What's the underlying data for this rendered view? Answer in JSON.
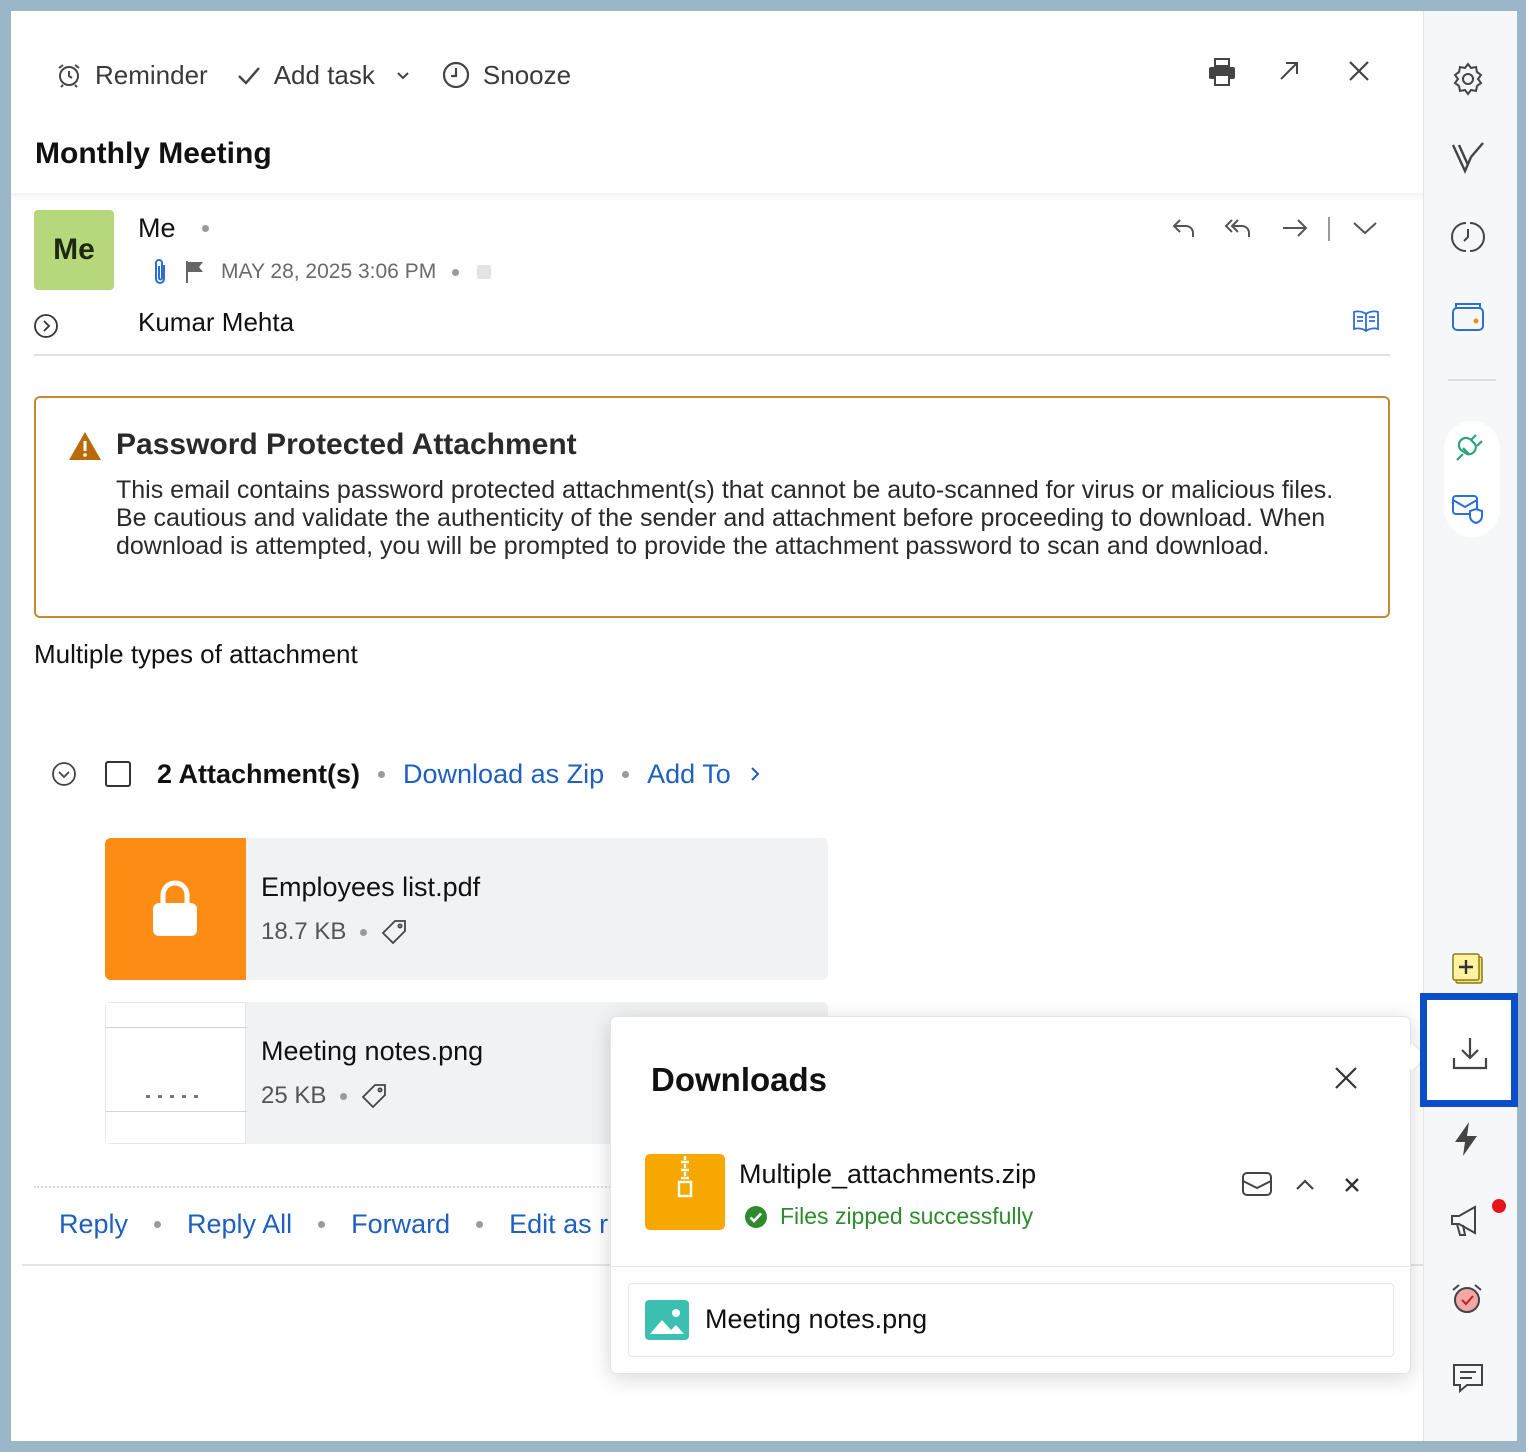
{
  "toolbar": {
    "reminder_label": "Reminder",
    "add_task_label": "Add task",
    "snooze_label": "Snooze"
  },
  "email": {
    "subject": "Monthly Meeting",
    "avatar_initials": "Me",
    "sender": "Me",
    "date": "MAY 28, 2025 3:06 PM",
    "recipient": "Kumar Mehta",
    "body": "Multiple types of attachment"
  },
  "warning": {
    "title": "Password Protected Attachment",
    "message": "This email contains password protected attachment(s) that cannot be auto-scanned for virus or malicious files. Be cautious and validate the authenticity of the sender and attachment before proceeding to download. When download is attempted, you will be prompted to provide the attachment password to scan and download.",
    "border_color": "#c8882d"
  },
  "attachments": {
    "count_label": "2 Attachment(s)",
    "download_zip_label": "Download as Zip",
    "add_to_label": "Add To",
    "items": [
      {
        "name": "Employees list.pdf",
        "size": "18.7 KB",
        "thumb_color": "#fd8c14"
      },
      {
        "name": "Meeting notes.png",
        "size": "25 KB"
      }
    ]
  },
  "reply_actions": {
    "reply": "Reply",
    "reply_all": "Reply All",
    "forward": "Forward",
    "edit_as": "Edit as r"
  },
  "downloads": {
    "title": "Downloads",
    "items": [
      {
        "name": "Multiple_attachments.zip",
        "status": "Files zipped successfully",
        "icon": "zip-icon"
      },
      {
        "name": "Meeting notes.png",
        "icon": "image-icon"
      }
    ]
  },
  "colors": {
    "link_blue": "#1f5fbf",
    "highlight_blue": "#0a4fc9",
    "success_green": "#2e8b2e",
    "avatar_green": "#b6d77a"
  }
}
